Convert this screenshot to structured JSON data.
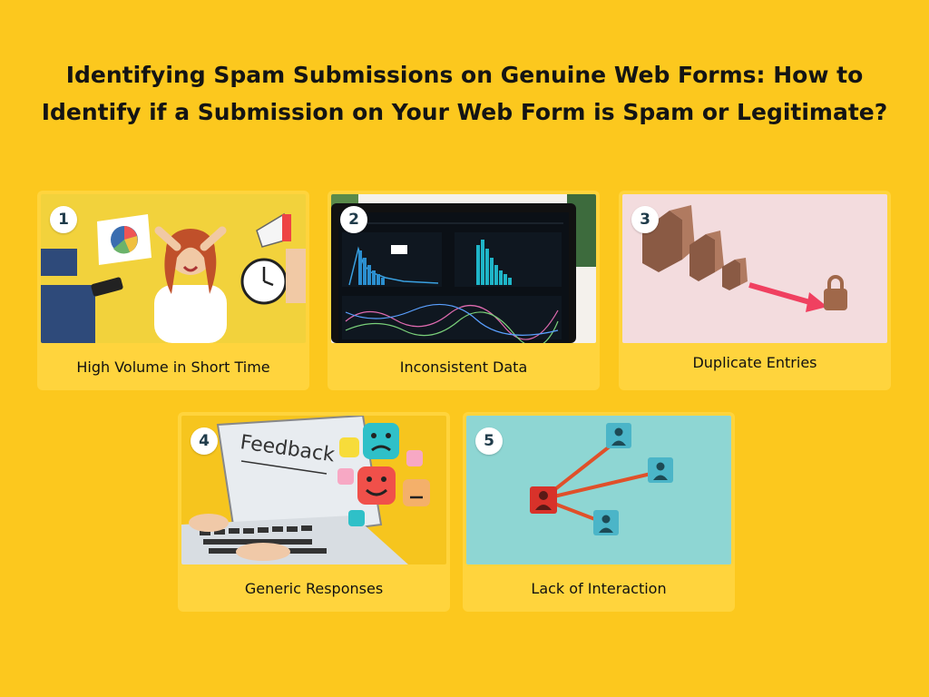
{
  "title": {
    "line1": "Identifying Spam Submissions on Genuine Web Forms: How to",
    "line2": "Identify if a Submission on Your Web Form is Spam or Legitimate?"
  },
  "cards": [
    {
      "number": "1",
      "label": "High Volume in Short Time"
    },
    {
      "number": "2",
      "label": "Inconsistent Data"
    },
    {
      "number": "3",
      "label": "Duplicate Entries"
    },
    {
      "number": "4",
      "label": "Generic Responses"
    },
    {
      "number": "5",
      "label": "Lack of Interaction"
    }
  ],
  "colors": {
    "background": "#FCC81E",
    "card": "#FFD43D",
    "badge": "#FFFFFF"
  }
}
